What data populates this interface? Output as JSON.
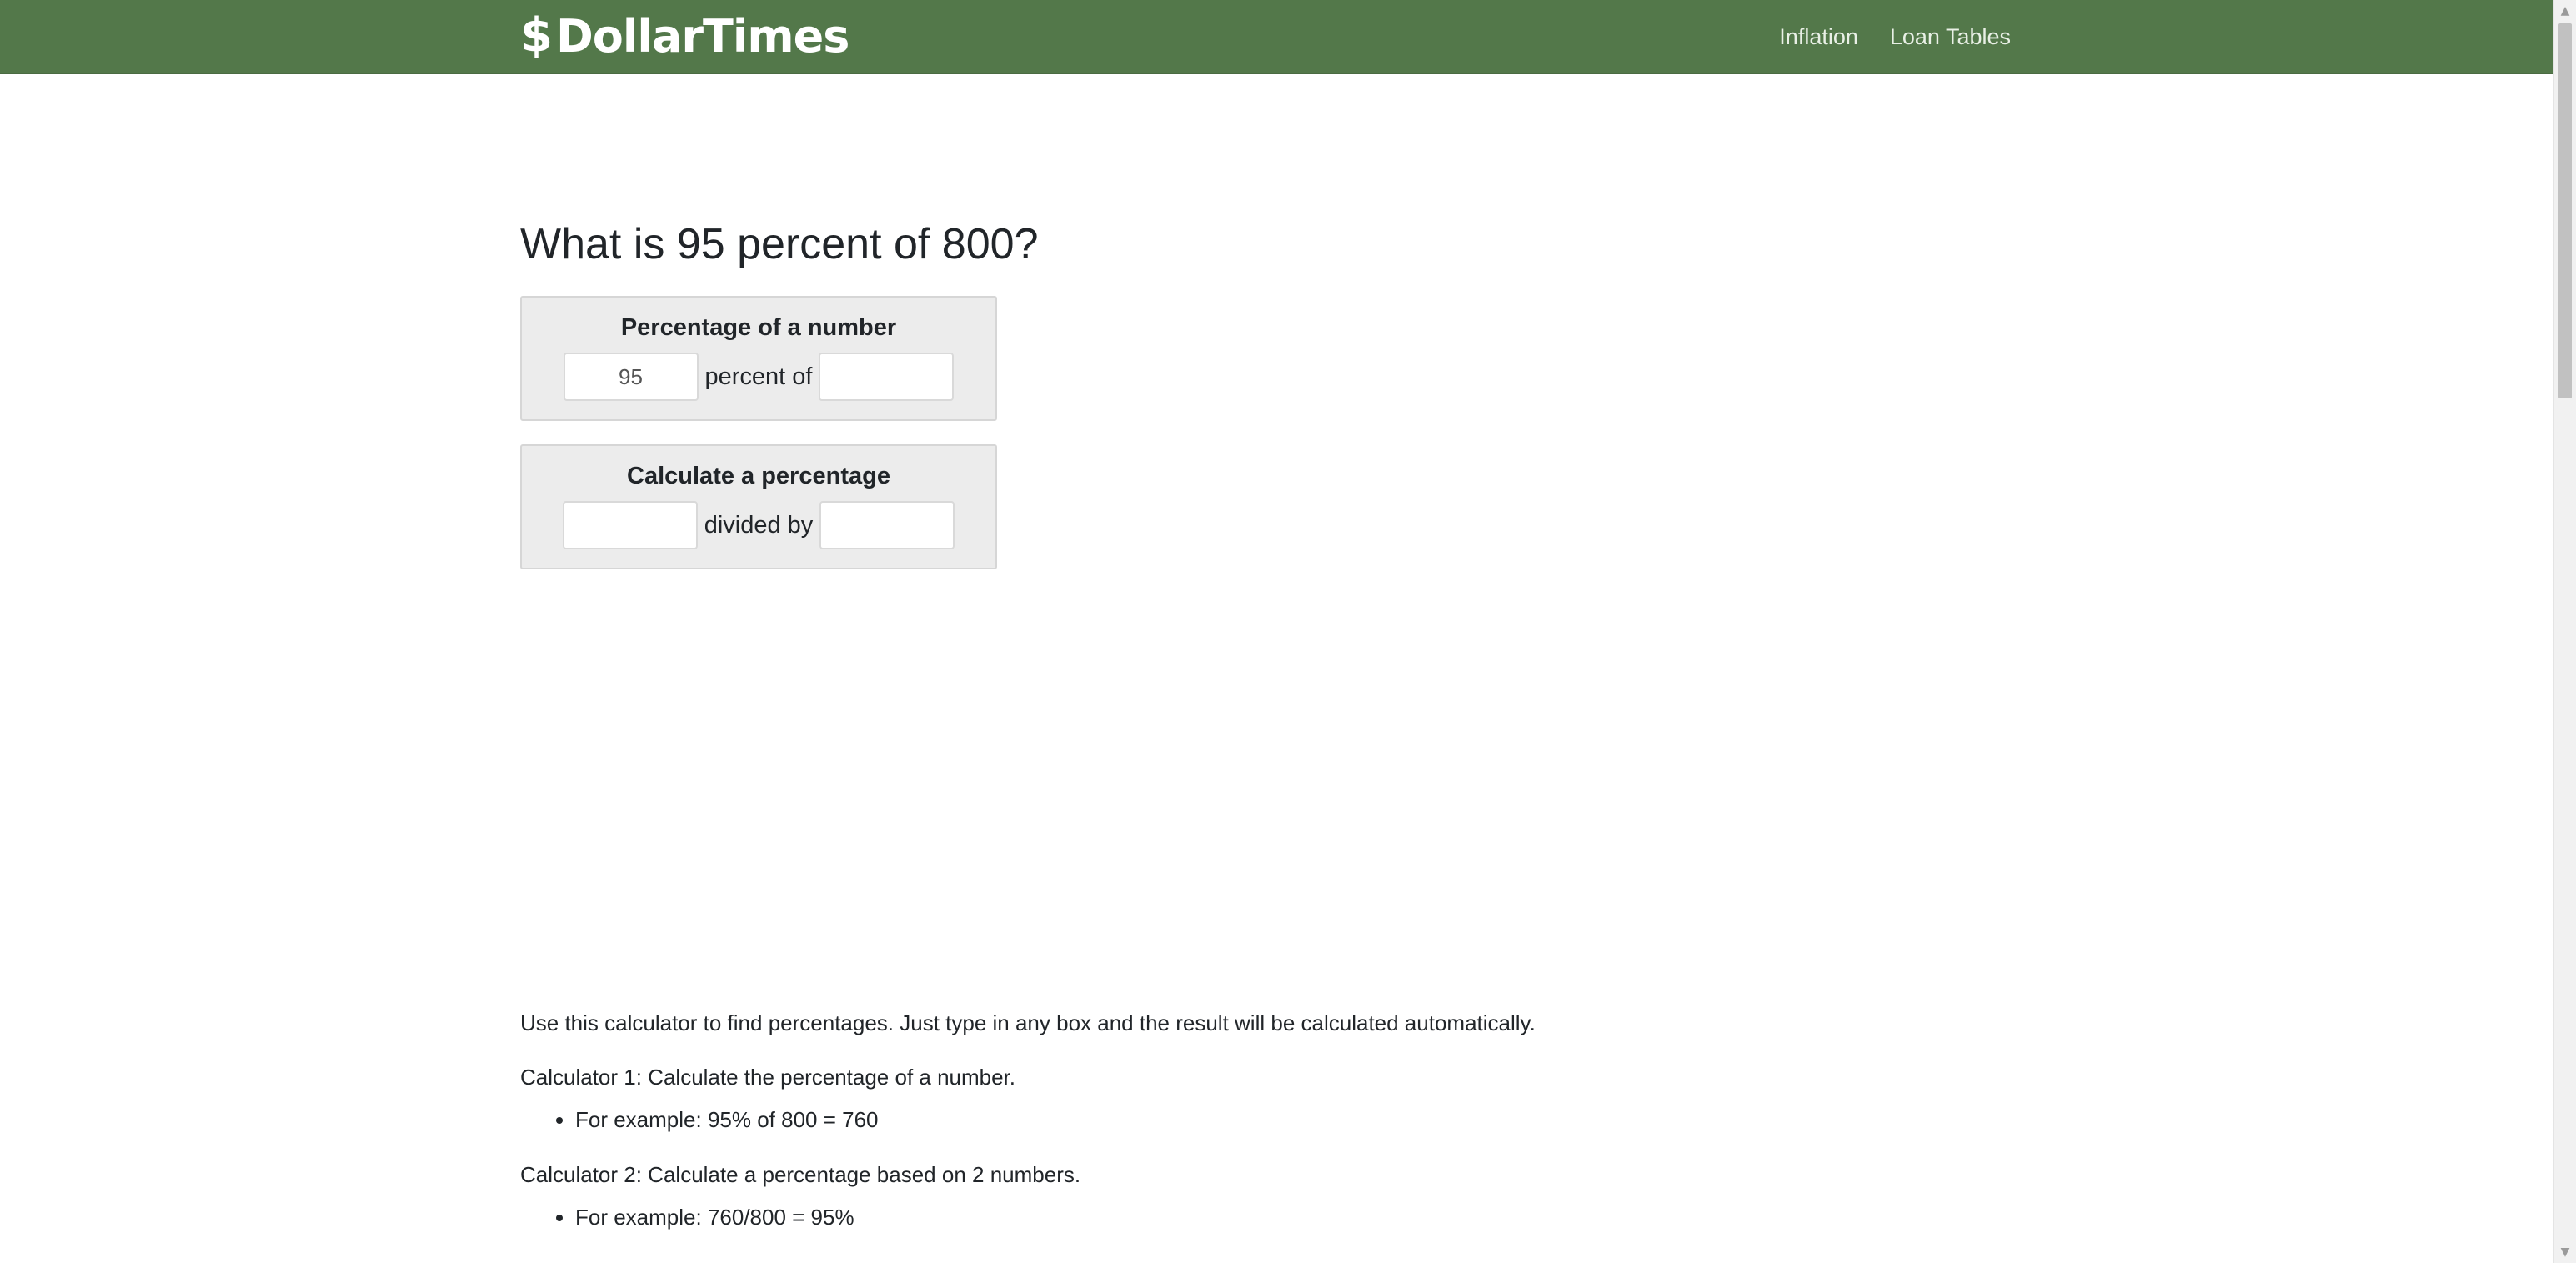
{
  "header": {
    "brand_mark": "$",
    "brand_name": "DollarTimes",
    "nav": [
      {
        "label": "Inflation"
      },
      {
        "label": "Loan Tables"
      }
    ],
    "bg_color": "#53784a"
  },
  "main": {
    "title": "What is 95 percent of 800?",
    "calculators": [
      {
        "title": "Percentage of a number",
        "first_value": "95",
        "connector": "percent of",
        "second_value": ""
      },
      {
        "title": "Calculate a percentage",
        "first_value": "",
        "connector": "divided by",
        "second_value": ""
      }
    ],
    "intro": "Use this calculator to find percentages. Just type in any box and the result will be calculated automatically.",
    "calc1_desc": "Calculator 1: Calculate the percentage of a number.",
    "calc1_example": "For example: 95% of 800 = 760",
    "calc2_desc": "Calculator 2: Calculate a percentage based on 2 numbers.",
    "calc2_example": "For example: 760/800 = 95%"
  }
}
